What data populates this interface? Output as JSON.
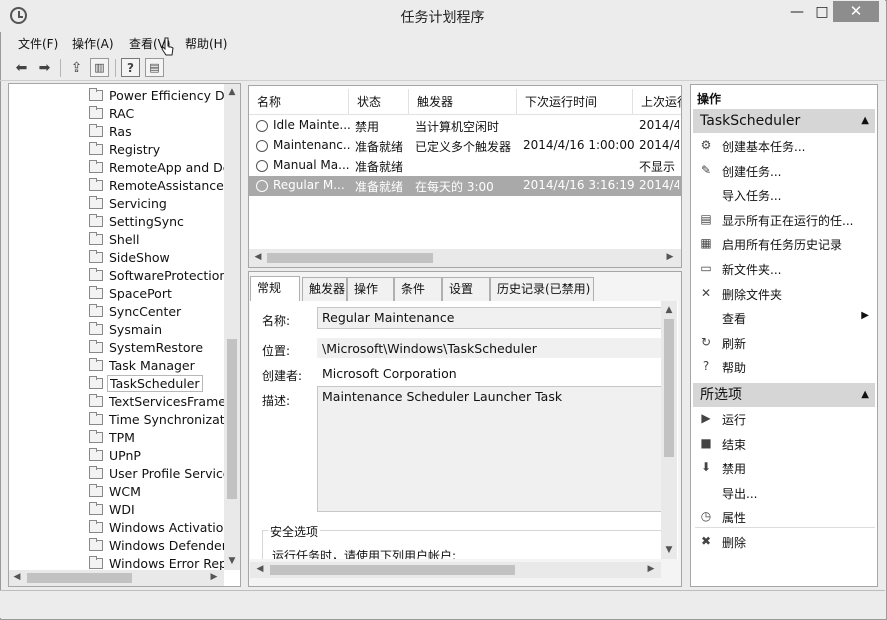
{
  "window": {
    "title": "任务计划程序",
    "minimize": "—",
    "maximize": "□",
    "close": "✕"
  },
  "menu": [
    "文件(F)",
    "操作(A)",
    "查看(V)",
    "帮助(H)"
  ],
  "tree": {
    "items": [
      "Power Efficiency Di",
      "RAC",
      "Ras",
      "Registry",
      "RemoteApp and De",
      "RemoteAssistance",
      "Servicing",
      "SettingSync",
      "Shell",
      "SideShow",
      "SoftwareProtection",
      "SpacePort",
      "SyncCenter",
      "Sysmain",
      "SystemRestore",
      "Task Manager",
      "TaskScheduler",
      "TextServicesFramev",
      "Time Synchronizati",
      "TPM",
      "UPnP",
      "User Profile Service",
      "WCM",
      "WDI",
      "Windows Activation",
      "Windows Defender",
      "Windows Error Rep"
    ]
  },
  "tasks": {
    "columns": [
      "名称",
      "状态",
      "触发器",
      "下次运行时间",
      "上次运行"
    ],
    "rows": [
      [
        "Idle Mainte...",
        "禁用",
        "当计算机空闲时",
        "",
        "2014/4"
      ],
      [
        "Maintenanc...",
        "准备就绪",
        "已定义多个触发器",
        "2014/4/16 1:00:00",
        "2014/4"
      ],
      [
        "Manual Ma...",
        "准备就绪",
        "",
        "",
        "不显示"
      ],
      [
        "Regular M...",
        "准备就绪",
        "在每天的 3:00",
        "2014/4/16 3:16:19",
        "2014/4"
      ]
    ]
  },
  "tabs": [
    "常规",
    "触发器",
    "操作",
    "条件",
    "设置",
    "历史记录(已禁用)"
  ],
  "general": {
    "name_label": "名称:",
    "name_value": "Regular Maintenance",
    "location_label": "位置:",
    "location_value": "\\Microsoft\\Windows\\TaskScheduler",
    "author_label": "创建者:",
    "author_value": "Microsoft Corporation",
    "desc_label": "描述:",
    "desc_value": "Maintenance Scheduler Launcher Task",
    "security_title": "安全选项",
    "security_text": "运行任务时，请使用下列用户帐户:"
  },
  "actions": {
    "header": "操作",
    "section1": "TaskScheduler",
    "section1_items": [
      {
        "label": "创建基本任务...",
        "icon": "⚙"
      },
      {
        "label": "创建任务...",
        "icon": "✎"
      },
      {
        "label": "导入任务...",
        "icon": ""
      },
      {
        "label": "显示所有正在运行的任...",
        "icon": "▤"
      },
      {
        "label": "启用所有任务历史记录",
        "icon": "▦"
      },
      {
        "label": "新文件夹...",
        "icon": "▭"
      },
      {
        "label": "删除文件夹",
        "icon": "✕"
      },
      {
        "label": "查看",
        "icon": ""
      },
      {
        "label": "刷新",
        "icon": "↻"
      },
      {
        "label": "帮助",
        "icon": "?"
      }
    ],
    "section2": "所选项",
    "section2_items": [
      {
        "label": "运行",
        "icon": "▶"
      },
      {
        "label": "结束",
        "icon": "■"
      },
      {
        "label": "禁用",
        "icon": "⬇"
      },
      {
        "label": "导出...",
        "icon": ""
      },
      {
        "label": "属性",
        "icon": "◷"
      },
      {
        "label": "删除",
        "icon": "✖"
      }
    ]
  }
}
